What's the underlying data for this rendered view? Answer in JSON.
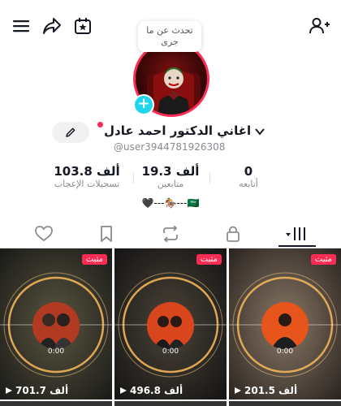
{
  "header": {
    "menu_icon": "menu-icon",
    "share_icon": "share-icon",
    "calendar_icon": "calendar-star-icon",
    "add_friend_icon": "add-user-icon"
  },
  "profile": {
    "bubble_text": "تحدث عن ما جرى",
    "display_name": "اغاني الدكتور احمد عادل",
    "handle": "@user3944781926308",
    "bio": "🖤---🏇---🇸🇦"
  },
  "stats": [
    {
      "value": "103.8 ألف",
      "label": "تسجيلات الإعجاب"
    },
    {
      "value": "19.3 ألف",
      "label": "متابعين"
    },
    {
      "value": "0",
      "label": "أتابعه"
    }
  ],
  "tabs": [
    "liked-tab",
    "favorites-tab",
    "reposts-tab",
    "private-tab",
    "videos-tab"
  ],
  "videos": [
    {
      "badge": "مثبت",
      "time": "0:00",
      "views": "701.7 ألف",
      "tone": "#6a6048"
    },
    {
      "badge": "مثبت",
      "time": "0:00",
      "views": "496.8 ألف",
      "tone": "#3e3a33"
    },
    {
      "badge": "مثبت",
      "time": "0:00",
      "views": "201.5 ألف",
      "tone": "#7a6656"
    }
  ],
  "colors": {
    "accent": "#fe2c55",
    "plus": "#20d5ec"
  }
}
